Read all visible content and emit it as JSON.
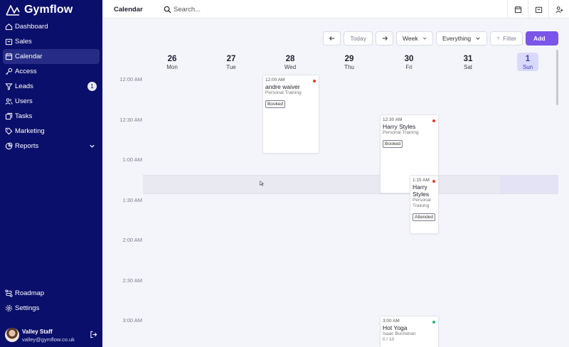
{
  "app": {
    "name": "Gymflow"
  },
  "sidebar": {
    "items": [
      {
        "label": "Dashboard",
        "icon": "home-icon"
      },
      {
        "label": "Sales",
        "icon": "sales-icon"
      },
      {
        "label": "Calendar",
        "icon": "calendar-icon",
        "active": true
      },
      {
        "label": "Access",
        "icon": "key-icon"
      },
      {
        "label": "Leads",
        "icon": "funnel-icon",
        "badge": "1"
      },
      {
        "label": "Users",
        "icon": "users-icon"
      },
      {
        "label": "Tasks",
        "icon": "tasks-icon"
      },
      {
        "label": "Marketing",
        "icon": "tag-icon"
      },
      {
        "label": "Reports",
        "icon": "reports-icon"
      }
    ],
    "bottom": [
      {
        "label": "Roadmap",
        "icon": "roadmap-icon"
      },
      {
        "label": "Settings",
        "icon": "gear-icon"
      }
    ],
    "user": {
      "name": "Valley Staff",
      "email": "valley@gymflow.co.uk"
    }
  },
  "topbar": {
    "title": "Calendar",
    "search_placeholder": "Search..."
  },
  "toolbar": {
    "today": "Today",
    "view": "Week",
    "filter_scope": "Everything",
    "filter": "Filter",
    "add": "Add"
  },
  "days": [
    {
      "num": "26",
      "name": "Mon"
    },
    {
      "num": "27",
      "name": "Tue"
    },
    {
      "num": "28",
      "name": "Wed"
    },
    {
      "num": "29",
      "name": "Thu"
    },
    {
      "num": "30",
      "name": "Fri"
    },
    {
      "num": "31",
      "name": "Sat"
    },
    {
      "num": "1",
      "name": "Sun",
      "today": true
    }
  ],
  "times": [
    "12:00 AM",
    "12:30 AM",
    "1:00 AM",
    "1:30 AM",
    "2:00 AM",
    "2:30 AM",
    "3:00 AM"
  ],
  "events": [
    {
      "time": "12:00 AM",
      "title": "andre waiver",
      "subtitle": "Personal Training",
      "tag": "Booked",
      "status_color": "#e53935"
    },
    {
      "time": "12:30 AM",
      "title": "Harry Styles",
      "subtitle": "Personal Training",
      "tag": "Booked",
      "status_color": "#e53935"
    },
    {
      "time": "1:15 AM",
      "title": "Harry Styles",
      "subtitle": "Personal Training",
      "tag": "Attended",
      "status_color": "#e53935"
    },
    {
      "time": "3:00 AM",
      "title": "Hot Yoga",
      "subtitle": "Isaac Buchanan",
      "capacity": "0 / 10",
      "status_color": "#2bb673"
    }
  ],
  "colors": {
    "sidebar": "#0a0f6b",
    "accent": "#7b55e8",
    "today_bg": "#d9d9fb"
  }
}
